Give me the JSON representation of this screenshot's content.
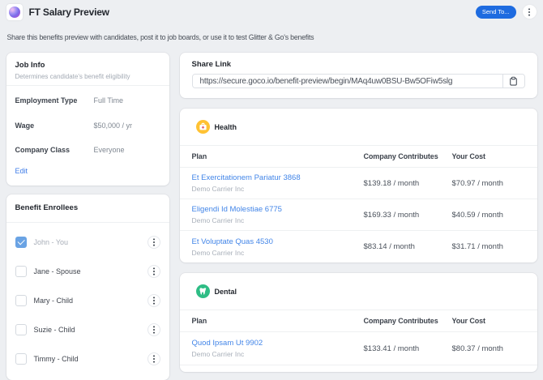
{
  "header": {
    "title": "FT Salary Preview",
    "subtitle": "Share this benefits preview with candidates, post it to job boards, or use it to test Glitter & Go's benefits",
    "send_button": "Send To...",
    "accent_color": "#1e6be0"
  },
  "job_info": {
    "title": "Job Info",
    "subtitle": "Determines candidate's benefit eligibility",
    "fields": [
      {
        "label": "Employment Type",
        "value": "Full Time"
      },
      {
        "label": "Wage",
        "value": "$50,000 / yr"
      },
      {
        "label": "Company Class",
        "value": "Everyone"
      }
    ],
    "edit_link": "Edit"
  },
  "benefit_enrollees": {
    "title": "Benefit Enrollees",
    "people": [
      {
        "name": "John - You",
        "checked": true
      },
      {
        "name": "Jane - Spouse",
        "checked": false
      },
      {
        "name": "Mary - Child",
        "checked": false
      },
      {
        "name": "Suzie - Child",
        "checked": false
      },
      {
        "name": "Timmy - Child",
        "checked": false
      }
    ]
  },
  "share_link": {
    "title": "Share Link",
    "url": "https://secure.goco.io/benefit-preview/begin/MAq4uw0BSU-Bw5OFiw5slg"
  },
  "benefits": [
    {
      "name": "Health",
      "icon": "medical-kit",
      "icon_color": "#ffc233",
      "columns": [
        "Plan",
        "Company Contributes",
        "Your Cost"
      ],
      "plans": [
        {
          "name": "Et Exercitationem Pariatur 3868",
          "carrier": "Demo Carrier Inc",
          "company_contributes": "$139.18 / month",
          "your_cost": "$70.97 / month"
        },
        {
          "name": "Eligendi Id Molestiae 6775",
          "carrier": "Demo Carrier Inc",
          "company_contributes": "$169.33 / month",
          "your_cost": "$40.59 / month"
        },
        {
          "name": "Et Voluptate Quas 4530",
          "carrier": "Demo Carrier Inc",
          "company_contributes": "$83.14 / month",
          "your_cost": "$31.71 / month"
        }
      ]
    },
    {
      "name": "Dental",
      "icon": "tooth",
      "icon_color": "#2ebd85",
      "columns": [
        "Plan",
        "Company Contributes",
        "Your Cost"
      ],
      "plans": [
        {
          "name": "Quod Ipsam Ut 9902",
          "carrier": "Demo Carrier Inc",
          "company_contributes": "$133.41 / month",
          "your_cost": "$80.37 / month"
        }
      ]
    }
  ]
}
